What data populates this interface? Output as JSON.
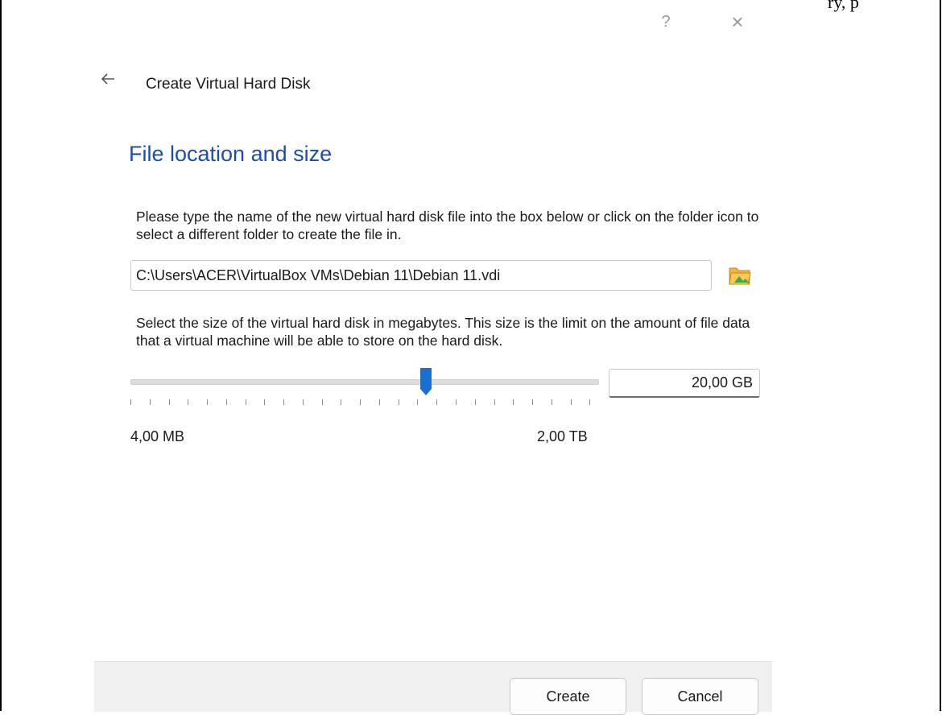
{
  "page_cut_text": "ry, p",
  "titlebar": {
    "help_label": "?",
    "close_label": "×"
  },
  "wizard": {
    "back_icon": "back-arrow-icon",
    "title": "Create Virtual Hard Disk",
    "heading": "File location and size"
  },
  "location": {
    "description": "Please type the name of the new virtual hard disk file into the box below or click on the folder icon to select a different folder to create the file in.",
    "path_value": "C:\\Users\\ACER\\VirtualBox VMs\\Debian 11\\Debian 11.vdi",
    "folder_icon": "folder-open-icon"
  },
  "size": {
    "description": "Select the size of the virtual hard disk in megabytes. This size is the limit on the amount of file data that a virtual machine will be able to store on the hard disk.",
    "value": "20,00 GB",
    "slider_fraction": 0.63,
    "min_label": "4,00 MB",
    "max_label": "2,00 TB",
    "tick_count": 25
  },
  "buttons": {
    "create_label": "Create",
    "cancel_label": "Cancel"
  },
  "colors": {
    "heading": "#1f4fa3",
    "slider_handle": "#1a6fd1",
    "footer_bg": "#f0f0f0"
  }
}
